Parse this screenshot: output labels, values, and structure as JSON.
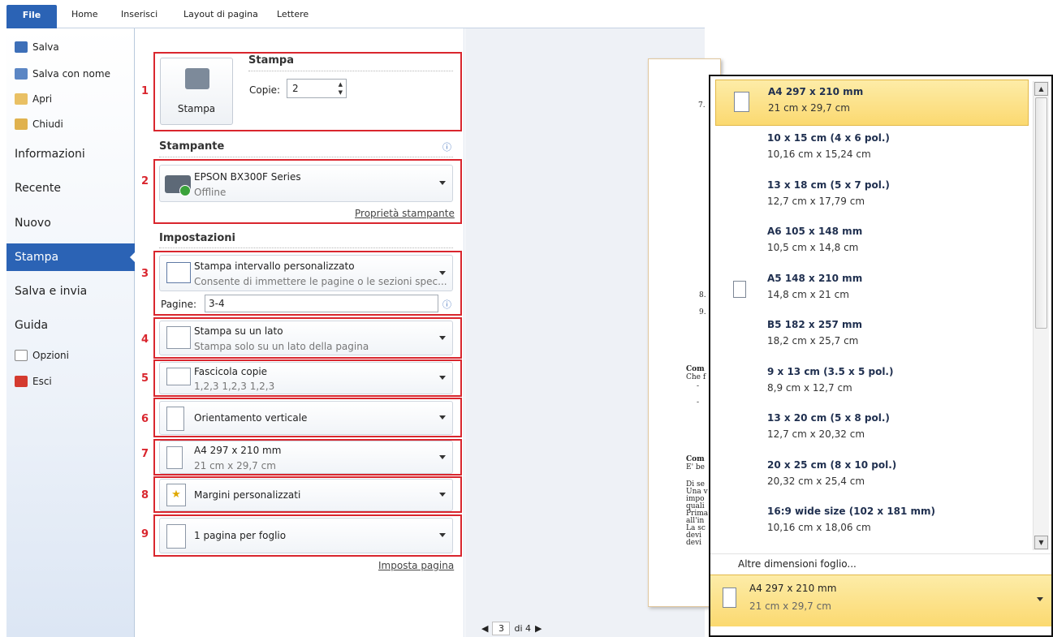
{
  "ribbon": {
    "file": "File",
    "tabs": [
      "Home",
      "Inserisci",
      "Layout di pagina",
      "Lettere"
    ]
  },
  "nav": {
    "salva": "Salva",
    "salva_con_nome": "Salva con nome",
    "apri": "Apri",
    "chiudi": "Chiudi",
    "informazioni": "Informazioni",
    "recente": "Recente",
    "nuovo": "Nuovo",
    "stampa": "Stampa",
    "salva_e_invia": "Salva e invia",
    "guida": "Guida",
    "opzioni": "Opzioni",
    "esci": "Esci"
  },
  "print": {
    "section_title": "Stampa",
    "button_label": "Stampa",
    "copies_label": "Copie:",
    "copies_value": "2",
    "printer_title": "Stampante",
    "printer_name": "EPSON BX300F Series",
    "printer_status": "Offline",
    "printer_props": "Proprietà stampante",
    "settings_title": "Impostazioni",
    "range_title": "Stampa intervallo personalizzato",
    "range_desc": "Consente di immettere le pagine o le sezioni spec...",
    "pages_label": "Pagine:",
    "pages_value": "3-4",
    "sides_title": "Stampa su un lato",
    "sides_desc": "Stampa solo su un lato della pagina",
    "collate_title": "Fascicola copie",
    "collate_desc": "1,2,3   1,2,3   1,2,3",
    "orientation": "Orientamento verticale",
    "size_title": "A4 297 x 210 mm",
    "size_desc": "21 cm x 29,7 cm",
    "margins": "Margini personalizzati",
    "pages_per_sheet": "1 pagina per foglio",
    "page_setup": "Imposta pagina"
  },
  "numbers": [
    "1",
    "2",
    "3",
    "4",
    "5",
    "6",
    "7",
    "8",
    "9"
  ],
  "preview_text": [
    "7.",
    "8.",
    "9.",
    "Com",
    "Che f",
    "-",
    "-",
    "Com",
    "E' be",
    "Di se",
    "Una v",
    "impo",
    "quali",
    "Prima",
    "all'in",
    "La sc",
    "devi ",
    "devi "
  ],
  "pager": {
    "current": "3",
    "of": "di 4"
  },
  "paper_options": [
    {
      "title": "A4 297 x 210 mm",
      "sub": "21 cm x 29,7 cm"
    },
    {
      "title": "10 x 15 cm (4 x 6 pol.)",
      "sub": "10,16 cm x 15,24 cm"
    },
    {
      "title": "13 x 18 cm (5 x 7 pol.)",
      "sub": "12,7 cm x 17,79 cm"
    },
    {
      "title": "A6 105 x 148 mm",
      "sub": "10,5 cm x 14,8 cm"
    },
    {
      "title": "A5 148 x 210 mm",
      "sub": "14,8 cm x 21 cm"
    },
    {
      "title": "B5 182 x 257 mm",
      "sub": "18,2 cm x 25,7 cm"
    },
    {
      "title": "9 x 13 cm (3.5 x 5 pol.)",
      "sub": "8,9 cm x 12,7 cm"
    },
    {
      "title": "13 x 20 cm (5 x 8 pol.)",
      "sub": "12,7 cm x 20,32 cm"
    },
    {
      "title": "20 x 25 cm (8 x 10 pol.)",
      "sub": "20,32 cm x 25,4 cm"
    },
    {
      "title": "16:9 wide size (102 x 181 mm)",
      "sub": "10,16 cm x 18,06 cm"
    }
  ],
  "more_sizes": "Altre dimensioni foglio...",
  "selected": {
    "title": "A4 297 x 210 mm",
    "sub": "21 cm x 29,7 cm"
  }
}
